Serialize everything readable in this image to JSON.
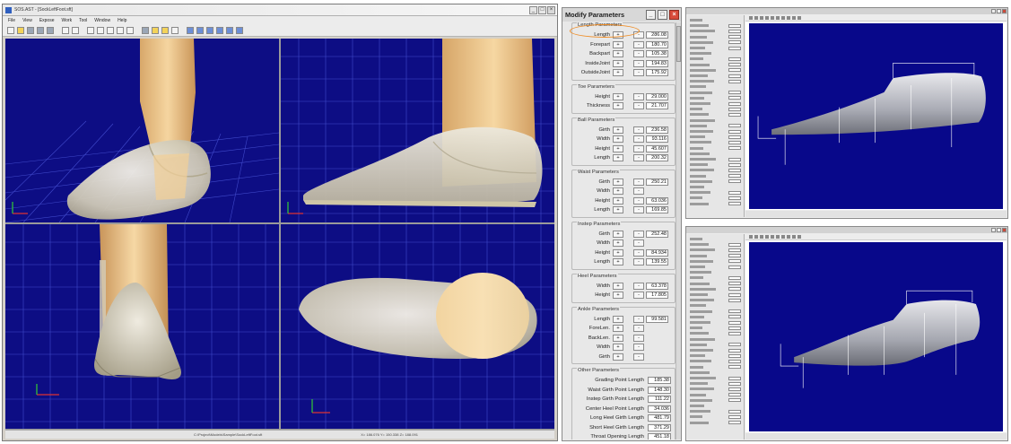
{
  "app": {
    "title": "SOS.AST - [SockLeftFoot.sft]",
    "menu": [
      "File",
      "View",
      "Expose",
      "Work",
      "Tool",
      "Window",
      "Help"
    ],
    "window_buttons": [
      "_",
      "□",
      "×"
    ],
    "status_path": "C:\\Project\\Models\\Sample\\SockLeftFoot.sft",
    "status_coords": "X= 186.076  Y= 150.338  Z= 188.091"
  },
  "panel": {
    "title": "Modify Parameters",
    "buttons": [
      "_",
      "□",
      "×"
    ],
    "plus": "+",
    "minus": "-",
    "groups": [
      {
        "label": "Length Parameters",
        "rows": [
          {
            "name": "Length",
            "value": "286.08"
          },
          {
            "name": "Forepart",
            "value": "180.70"
          },
          {
            "name": "Backpart",
            "value": "105.38"
          },
          {
            "name": "InsideJoint",
            "value": "194.83"
          },
          {
            "name": "OutsideJoint",
            "value": "175.92"
          }
        ]
      },
      {
        "label": "Toe Parameters",
        "rows": [
          {
            "name": "Height",
            "value": "29.000"
          },
          {
            "name": "Thickness",
            "value": "21.707"
          }
        ]
      },
      {
        "label": "Ball Parameters",
        "rows": [
          {
            "name": "Girth",
            "value": "236.58"
          },
          {
            "name": "Width",
            "value": "93.116"
          },
          {
            "name": "Height",
            "value": "45.607"
          },
          {
            "name": "Length",
            "value": "200.32"
          }
        ]
      },
      {
        "label": "Waist Parameters",
        "rows": [
          {
            "name": "Girth",
            "value": "250.21"
          },
          {
            "name": "Width",
            "value": ""
          },
          {
            "name": "Height",
            "value": "63.036"
          },
          {
            "name": "Length",
            "value": "169.85"
          }
        ]
      },
      {
        "label": "Instep Parameters",
        "rows": [
          {
            "name": "Girth",
            "value": "252.48"
          },
          {
            "name": "Width",
            "value": ""
          },
          {
            "name": "Height",
            "value": "84.934"
          },
          {
            "name": "Length",
            "value": "139.55"
          }
        ]
      },
      {
        "label": "Heel Parameters",
        "rows": [
          {
            "name": "Width",
            "value": "63.378"
          },
          {
            "name": "Height",
            "value": "17.805"
          }
        ]
      },
      {
        "label": "Ankle Parameters",
        "rows": [
          {
            "name": "Length",
            "value": "99.581"
          },
          {
            "name": "ForeLen.",
            "value": ""
          },
          {
            "name": "BackLen.",
            "value": ""
          },
          {
            "name": "Width",
            "value": ""
          },
          {
            "name": "Girth",
            "value": ""
          }
        ]
      }
    ],
    "other": {
      "label": "Other Parameters",
      "rows": [
        {
          "name": "Grading Point Length",
          "value": "185.38"
        },
        {
          "name": "Waist Girth Point Length",
          "value": "148.30"
        },
        {
          "name": "Instep Girth Point Length",
          "value": "111.22"
        },
        {
          "name": "Center Heel Point Length",
          "value": "34.036"
        },
        {
          "name": "Long Heel Girth Length",
          "value": "481.79"
        },
        {
          "name": "Short Heel Girth Length",
          "value": "371.29"
        },
        {
          "name": "Throat Opening Length",
          "value": "451.18"
        }
      ]
    }
  },
  "colors": {
    "viewport_bg": "#0d0d84",
    "grid": "#4a55d8",
    "highlight": "#ef8b22",
    "skin": "#f0c98f",
    "sock": "#d6d2c4"
  }
}
